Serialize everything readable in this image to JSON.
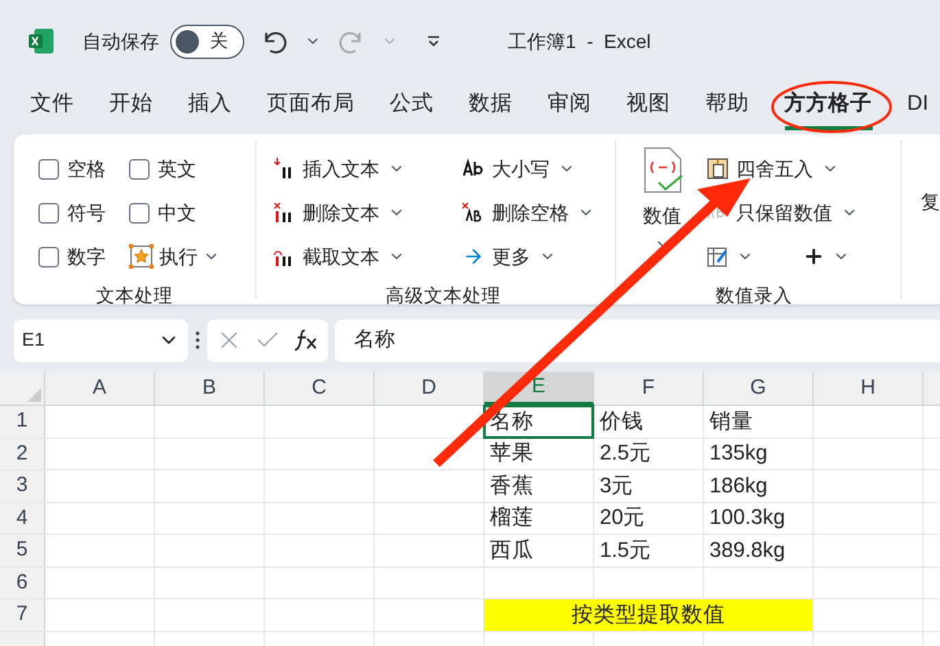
{
  "title_bar": {
    "autosave_label": "自动保存",
    "toggle": {
      "label": "关",
      "on": false
    },
    "title": "工作簿1  -  Excel"
  },
  "tabs": [
    {
      "label": "文件",
      "selected": false
    },
    {
      "label": "开始",
      "selected": false
    },
    {
      "label": "插入",
      "selected": false
    },
    {
      "label": "页面布局",
      "selected": false
    },
    {
      "label": "公式",
      "selected": false
    },
    {
      "label": "数据",
      "selected": false
    },
    {
      "label": "审阅",
      "selected": false
    },
    {
      "label": "视图",
      "selected": false
    },
    {
      "label": "帮助",
      "selected": false
    },
    {
      "label": "方方格子",
      "selected": true
    },
    {
      "label": "DI",
      "selected": false
    }
  ],
  "ribbon": {
    "groups": [
      {
        "title": "文本处理",
        "items": [
          {
            "kind": "checkbox",
            "label": "空格",
            "checked": false
          },
          {
            "kind": "checkbox",
            "label": "英文",
            "checked": false
          },
          {
            "kind": "checkbox",
            "label": "符号",
            "checked": false
          },
          {
            "kind": "checkbox",
            "label": "中文",
            "checked": false
          },
          {
            "kind": "checkbox",
            "label": "数字",
            "checked": false
          },
          {
            "kind": "run",
            "label": "执行"
          }
        ]
      },
      {
        "title": "高级文本处理",
        "items": [
          {
            "kind": "insert",
            "label": "插入文本"
          },
          {
            "kind": "case",
            "label": "大小写"
          },
          {
            "kind": "delete",
            "label": "删除文本"
          },
          {
            "kind": "delspace",
            "label": "删除空格"
          },
          {
            "kind": "extract",
            "label": "截取文本"
          },
          {
            "kind": "more",
            "label": "更多"
          }
        ]
      },
      {
        "title": "数值录入",
        "big": {
          "label": "数值"
        },
        "items": [
          {
            "kind": "round",
            "label": "四舍五入"
          },
          {
            "kind": "keep",
            "label": "只保留数值"
          },
          {
            "kind": "edit"
          },
          {
            "kind": "plus"
          }
        ]
      }
    ],
    "cut_label": "复"
  },
  "formula_bar": {
    "name_box": "E1",
    "formula": "名称"
  },
  "sheet": {
    "columns": [
      {
        "label": "A",
        "selected": false
      },
      {
        "label": "B",
        "selected": false
      },
      {
        "label": "C",
        "selected": false
      },
      {
        "label": "D",
        "selected": false
      },
      {
        "label": "E",
        "selected": true
      },
      {
        "label": "F",
        "selected": false
      },
      {
        "label": "G",
        "selected": false
      },
      {
        "label": "H",
        "selected": false
      }
    ],
    "rows": [
      {
        "number": "1",
        "values": [
          {
            "text": "名称",
            "selected": true
          },
          {
            "text": "价钱",
            "selected": false
          },
          {
            "text": "销量",
            "selected": false
          }
        ]
      },
      {
        "number": "2",
        "values": [
          {
            "text": "苹果",
            "selected": false
          },
          {
            "text": "2.5元",
            "selected": false
          },
          {
            "text": "135kg",
            "selected": false
          }
        ]
      },
      {
        "number": "3",
        "values": [
          {
            "text": "香蕉",
            "selected": false
          },
          {
            "text": "3元",
            "selected": false
          },
          {
            "text": "186kg",
            "selected": false
          }
        ]
      },
      {
        "number": "4",
        "values": [
          {
            "text": "榴莲",
            "selected": false
          },
          {
            "text": "20元",
            "selected": false
          },
          {
            "text": "100.3kg",
            "selected": false
          }
        ]
      },
      {
        "number": "5",
        "values": [
          {
            "text": "西瓜",
            "selected": false
          },
          {
            "text": "1.5元",
            "selected": false
          },
          {
            "text": "389.8kg",
            "selected": false
          }
        ]
      },
      {
        "number": "6"
      },
      {
        "number": "7",
        "banner": "按类型提取数值"
      }
    ]
  }
}
